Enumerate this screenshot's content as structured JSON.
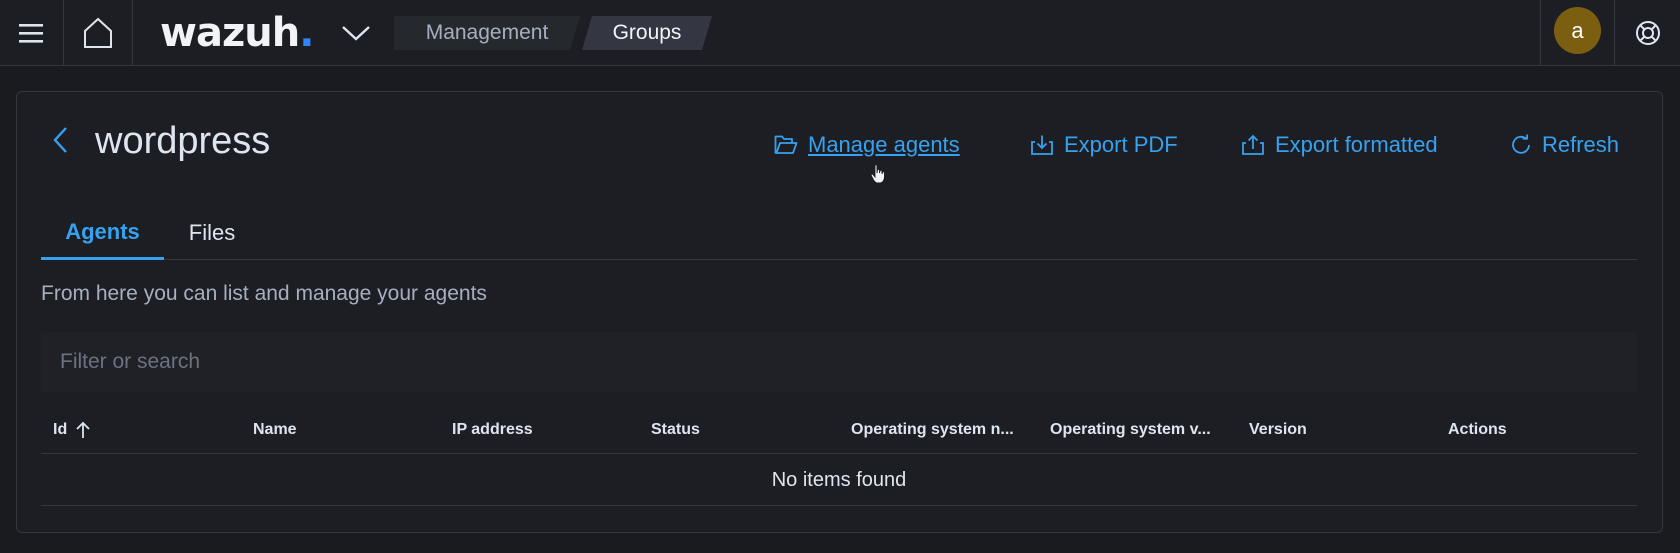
{
  "header": {
    "logo": {
      "text": "wazuh",
      "dot": "."
    },
    "breadcrumb": [
      "Management",
      "Groups"
    ],
    "avatar_initial": "a",
    "icons": [
      "menu-icon",
      "home-icon",
      "chevron-down-icon",
      "help-icon"
    ]
  },
  "page": {
    "title": "wordpress",
    "actions": {
      "manage_agents": "Manage agents",
      "export_pdf": "Export PDF",
      "export_formatted": "Export formatted",
      "refresh": "Refresh"
    },
    "tabs": [
      {
        "label": "Agents",
        "selected": true
      },
      {
        "label": "Files",
        "selected": false
      }
    ],
    "description": "From here you can list and manage your agents",
    "search": {
      "placeholder": "Filter or search",
      "value": ""
    },
    "table": {
      "columns": [
        "Id",
        "Name",
        "IP address",
        "Status",
        "Operating system n...",
        "Operating system v...",
        "Version",
        "Actions"
      ],
      "sort": {
        "column": "Id",
        "direction": "ascending"
      },
      "empty_message": "No items found"
    }
  },
  "colors": {
    "background": "#1a1b1f",
    "panel": "#1d1e24",
    "accent": "#36a2ef",
    "avatar": "#7c5e10",
    "logo_dot": "#3185fc"
  }
}
